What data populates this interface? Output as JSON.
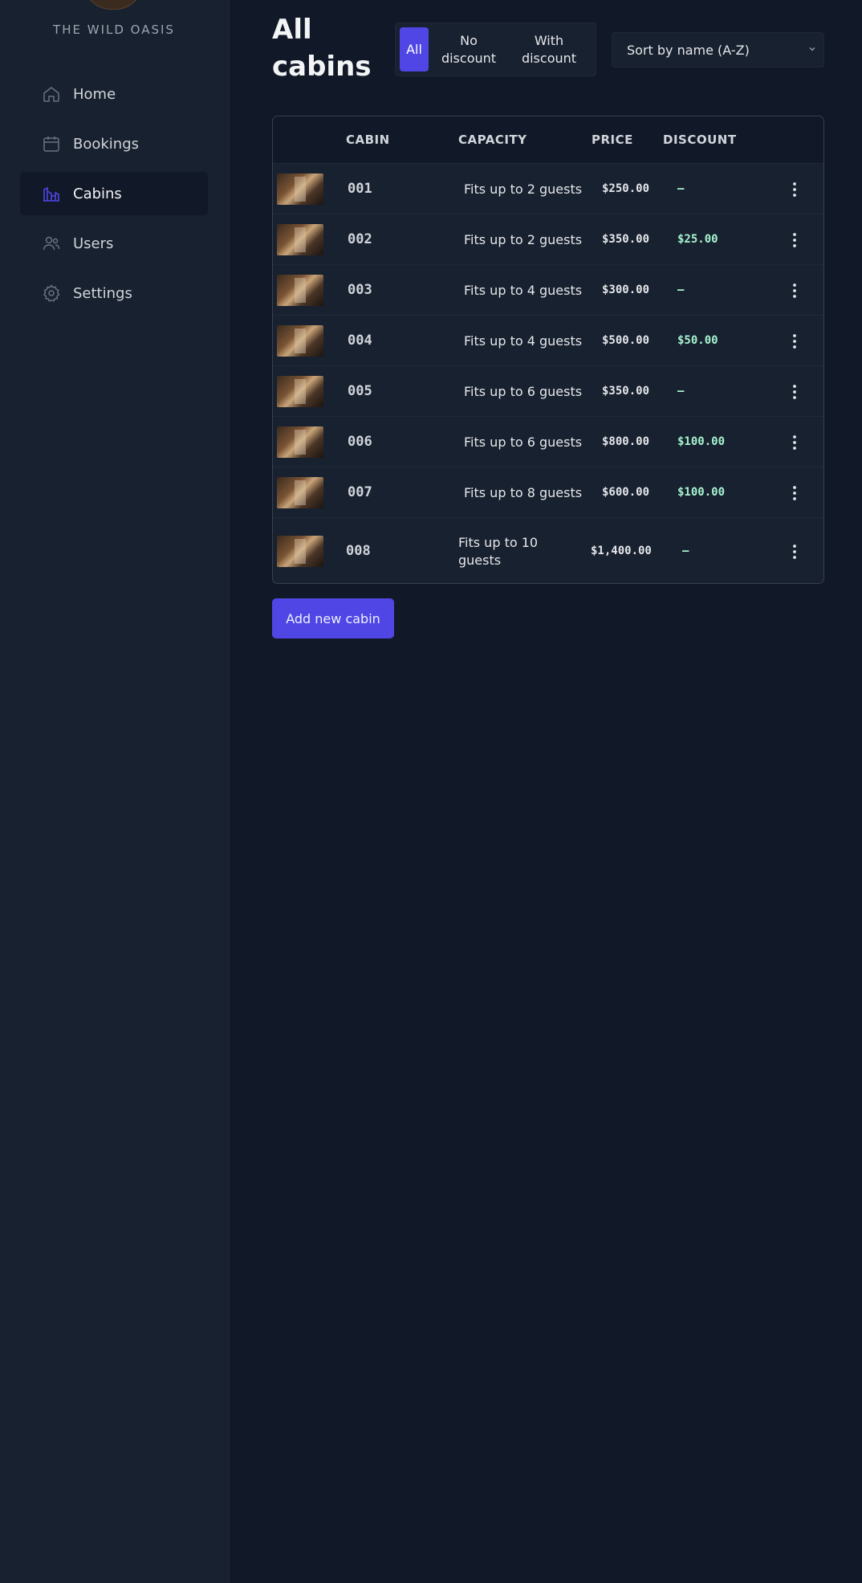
{
  "sidebar": {
    "brand": "THE WILD OASIS",
    "items": [
      {
        "label": "Home",
        "icon": "home-icon"
      },
      {
        "label": "Bookings",
        "icon": "calendar-icon"
      },
      {
        "label": "Cabins",
        "icon": "cabins-icon"
      },
      {
        "label": "Users",
        "icon": "users-icon"
      },
      {
        "label": "Settings",
        "icon": "gear-icon"
      }
    ],
    "active": "Cabins"
  },
  "header": {
    "title": "All cabins"
  },
  "filter": {
    "options": [
      "All",
      "No discount",
      "With discount"
    ],
    "selected": "All"
  },
  "sort": {
    "selected": "Sort by name (A-Z)"
  },
  "table": {
    "columns": [
      "",
      "CABIN",
      "CAPACITY",
      "PRICE",
      "DISCOUNT",
      ""
    ],
    "rows": [
      {
        "cabin": "001",
        "capacity": "Fits up to 2 guests",
        "price": "$250.00",
        "discount": "—"
      },
      {
        "cabin": "002",
        "capacity": "Fits up to 2 guests",
        "price": "$350.00",
        "discount": "$25.00"
      },
      {
        "cabin": "003",
        "capacity": "Fits up to 4 guests",
        "price": "$300.00",
        "discount": "—"
      },
      {
        "cabin": "004",
        "capacity": "Fits up to 4 guests",
        "price": "$500.00",
        "discount": "$50.00"
      },
      {
        "cabin": "005",
        "capacity": "Fits up to 6 guests",
        "price": "$350.00",
        "discount": "—"
      },
      {
        "cabin": "006",
        "capacity": "Fits up to 6 guests",
        "price": "$800.00",
        "discount": "$100.00"
      },
      {
        "cabin": "007",
        "capacity": "Fits up to 8 guests",
        "price": "$600.00",
        "discount": "$100.00"
      },
      {
        "cabin": "008",
        "capacity": "Fits up to 10 guests",
        "price": "$1,400.00",
        "discount": "—"
      }
    ]
  },
  "actions": {
    "add_label": "Add new cabin"
  },
  "colors": {
    "accent": "#4f46e5",
    "background": "#111827",
    "sidebar": "#18212f",
    "discount_text": "#a7f3d0"
  }
}
